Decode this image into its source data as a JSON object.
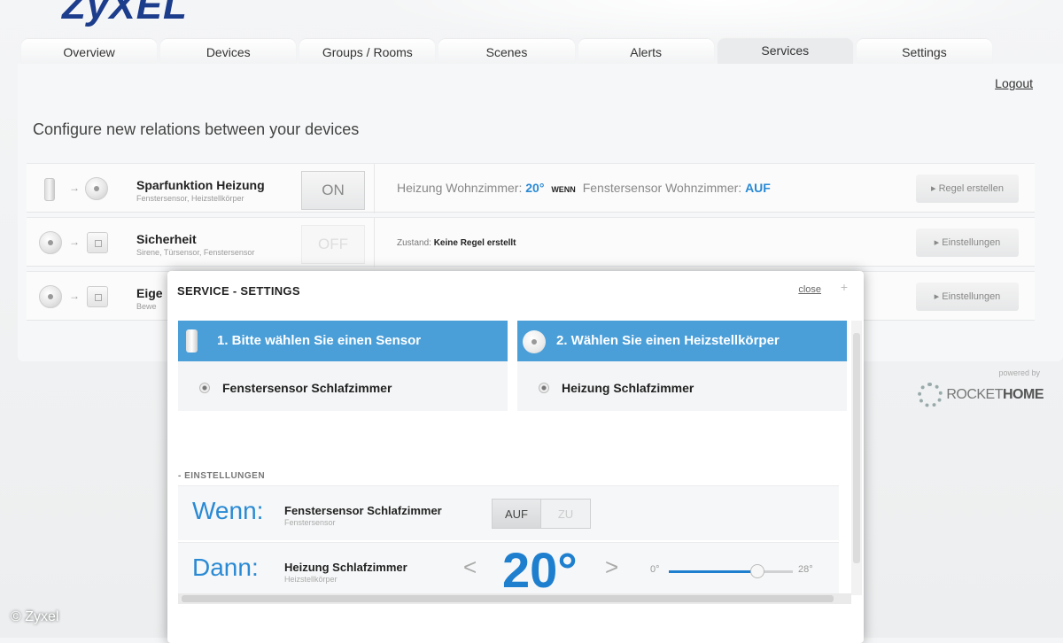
{
  "brand": {
    "logo_text": "ZyXEL"
  },
  "tabs": [
    {
      "label": "Overview"
    },
    {
      "label": "Devices"
    },
    {
      "label": "Groups / Rooms"
    },
    {
      "label": "Scenes"
    },
    {
      "label": "Alerts"
    },
    {
      "label": "Services",
      "active": true
    },
    {
      "label": "Settings"
    }
  ],
  "header": {
    "logout": "Logout"
  },
  "page": {
    "title": "Configure new relations between your devices"
  },
  "services": [
    {
      "name": "Sparfunktion Heizung",
      "sub": "Fenstersensor, Heizstellkörper",
      "toggle": "ON",
      "desc_a": "Heizung Wohnzimmer: ",
      "desc_a_val": "20°",
      "desc_wenn": "WENN",
      "desc_b": "Fenstersensor Wohnzimmer: ",
      "desc_b_val": "AUF",
      "action": "▸ Regel erstellen"
    },
    {
      "name": "Sicherheit",
      "sub": "Sirene, Türsensor, Fenstersensor",
      "toggle": "OFF",
      "state_label": "Zustand:",
      "state_value": "Keine Regel erstellt",
      "action": "▸ Einstellungen"
    },
    {
      "name": "Eige",
      "sub": "Bewe",
      "action": "▸ Einstellungen"
    }
  ],
  "footer": {
    "powered_by": "powered by",
    "rocket_a": "ROCKET",
    "rocket_b": "HOME",
    "copyright": "© Zyxel"
  },
  "modal": {
    "title": "SERVICE - SETTINGS",
    "close": "close",
    "plus": "+",
    "col1": {
      "header": "1. Bitte wählen Sie einen Sensor",
      "item": "Fenstersensor Schlafzimmer"
    },
    "col2": {
      "header": "2. Wählen Sie einen Heizstellkörper",
      "item": "Heizung Schlafzimmer"
    },
    "section_label": "- EINSTELLUNGEN",
    "wenn": {
      "word": "Wenn:",
      "name": "Fenstersensor Schlafzimmer",
      "sub": "Fenstersensor",
      "opt_on": "AUF",
      "opt_off": "ZU"
    },
    "dann": {
      "word": "Dann:",
      "name": "Heizung Schlafzimmer",
      "sub": "Heizstellkörper",
      "prev": "<",
      "temperature": "20°",
      "next": ">",
      "slider_min": "0°",
      "slider_max": "28°",
      "slider_value": 20,
      "slider_range": [
        0,
        28
      ]
    }
  }
}
